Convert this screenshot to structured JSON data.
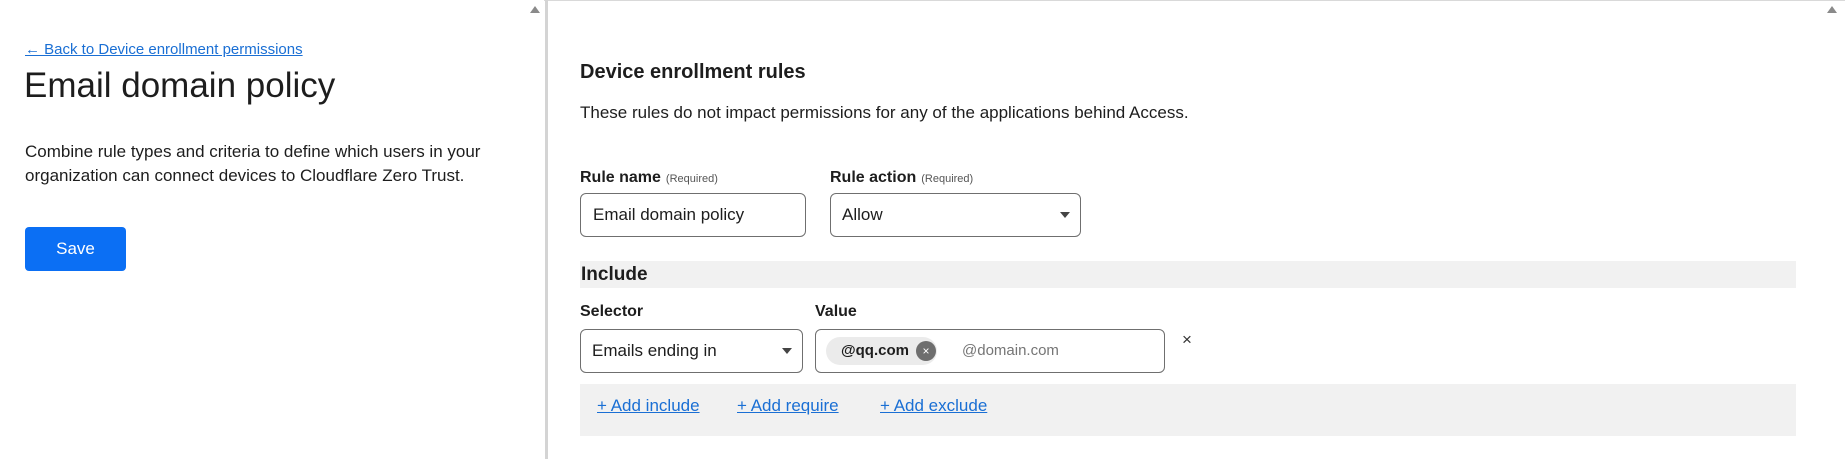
{
  "left": {
    "back_link": "← Back to Device enrollment permissions",
    "title": "Email domain policy",
    "description": "Combine rule types and criteria to define which users in your organization can connect devices to Cloudflare Zero Trust.",
    "save_label": "Save"
  },
  "rules": {
    "title": "Device enrollment rules",
    "description": "These rules do not impact permissions for any of the applications behind Access.",
    "rule_name": {
      "label": "Rule name",
      "required": "(Required)",
      "value": "Email domain policy"
    },
    "rule_action": {
      "label": "Rule action",
      "required": "(Required)",
      "value": "Allow"
    }
  },
  "include": {
    "title": "Include",
    "selector_label": "Selector",
    "selector_value": "Emails ending in",
    "value_label": "Value",
    "chip": "@qq.com",
    "chip_remove": "×",
    "value_placeholder": "@domain.com",
    "remove_row": "×"
  },
  "actions": {
    "add_include": "+ Add include",
    "add_require": "+ Add require",
    "add_exclude": "+ Add exclude"
  },
  "icons": {
    "scroll_up": "scroll-up-icon",
    "caret": "chevron-down-icon",
    "close": "close-icon"
  },
  "colors": {
    "accent": "#0b6ff4",
    "link": "#1a6fd4",
    "panel_bg": "#f1f1f1"
  }
}
